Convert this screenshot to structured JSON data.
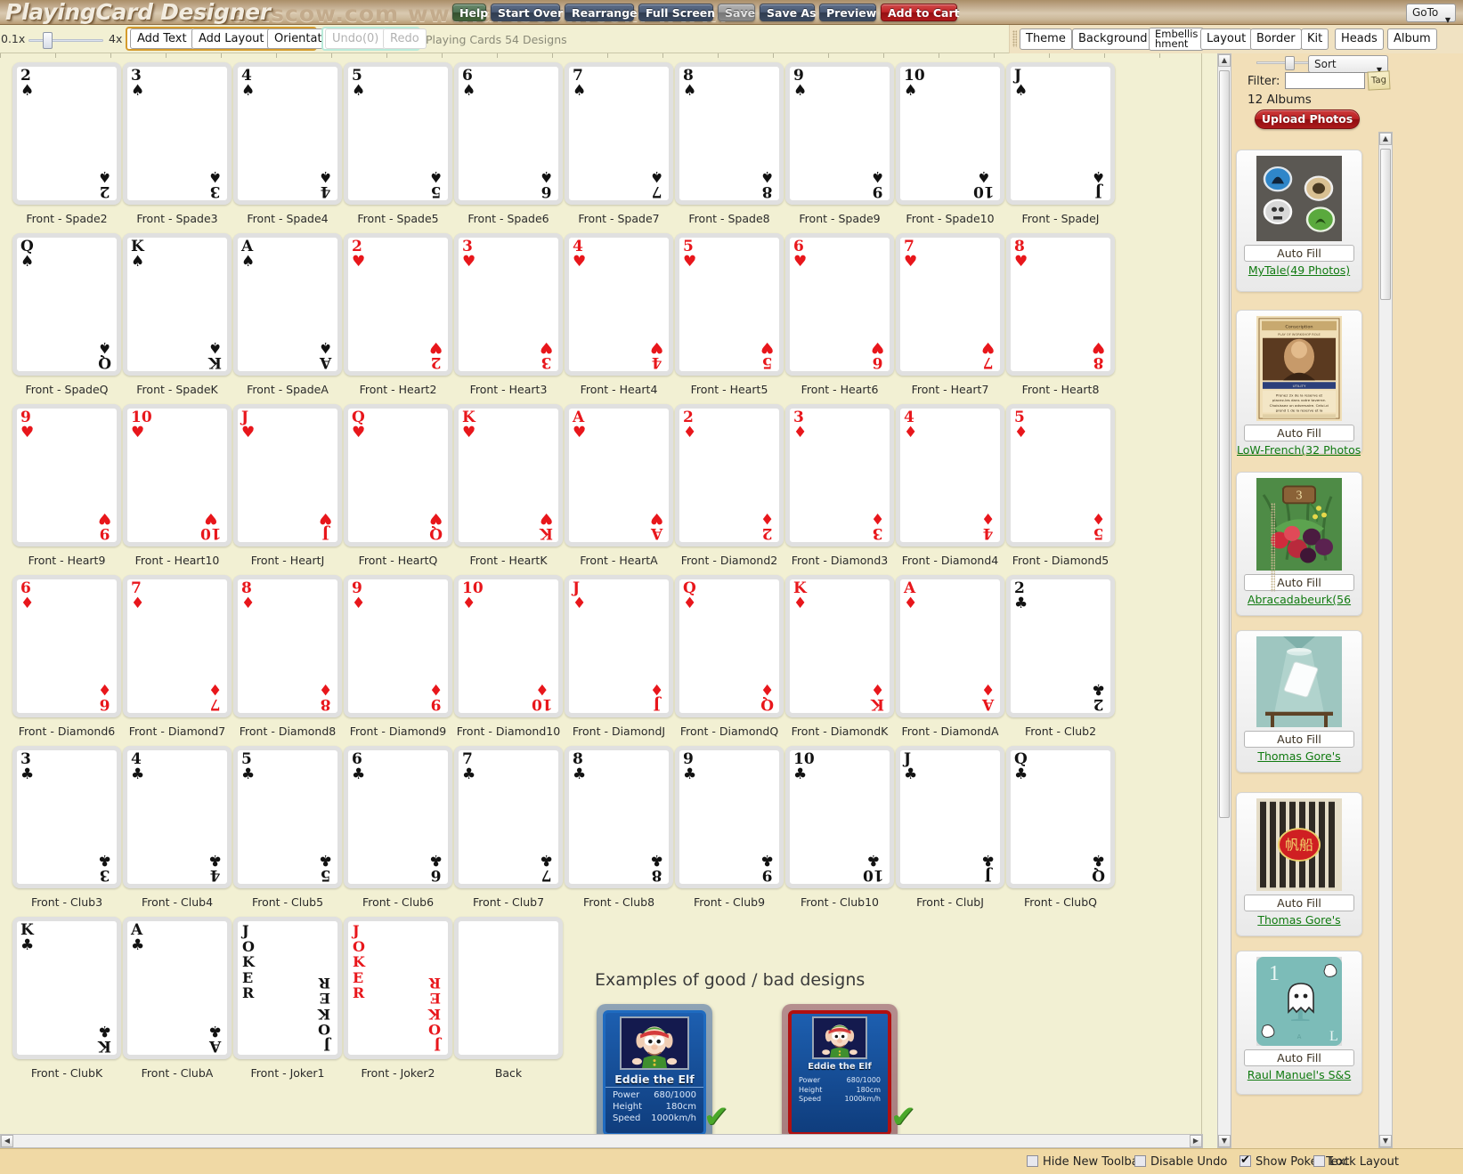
{
  "titlebar": {
    "app_title": "PlayingCard Designer",
    "watermark": "artscow.com www.artscow.com www.",
    "buttons": [
      {
        "label": "Help",
        "style": "green"
      },
      {
        "label": "Start Over",
        "style": "blue"
      },
      {
        "label": "Rearrange",
        "style": "blue"
      },
      {
        "label": "Full Screen",
        "style": "blue"
      },
      {
        "label": "Save",
        "style": "gray"
      },
      {
        "label": "Save As",
        "style": "blue"
      },
      {
        "label": "Preview",
        "style": "blue"
      },
      {
        "label": "Add to Cart",
        "style": "red"
      }
    ],
    "goto_label": "GoTo"
  },
  "toolbar": {
    "zoom_min": "0.1x",
    "zoom_max": "4x",
    "add_text": "Add Text",
    "add_layout": "Add Layout",
    "orientation": "Orientation",
    "undo": "Undo(0)",
    "redo": "Redo",
    "doc_label": "Playing Cards 54 Designs",
    "right_buttons": [
      "Theme",
      "Background",
      "Embellis|hment",
      "Layout",
      "Border",
      "Kit",
      "Heads",
      "Album"
    ]
  },
  "right_panel": {
    "sort_label": "Sort",
    "filter_label": "Filter:",
    "filter_value": "",
    "filter_placeholder": "",
    "tag_label": "Tag",
    "albums_count": "12 Albums",
    "upload_label": "Upload Photos",
    "auto_fill_label": "Auto Fill",
    "albums": [
      {
        "name": "MyTale(49 Photos)",
        "thumb": "tokens"
      },
      {
        "name": "LoW-French(32 Photos)",
        "thumb": "frenchcard"
      },
      {
        "name": "Abracadabeurk(56",
        "thumb": "berries"
      },
      {
        "name": "Thomas Gore's",
        "thumb": "lamp"
      },
      {
        "name": "Thomas Gore's",
        "thumb": "junk"
      },
      {
        "name": "Raul Manuel's S&S",
        "thumb": "ghost"
      }
    ]
  },
  "examples": {
    "title": "Examples of good / bad designs",
    "good": {
      "name": "Eddie the Elf",
      "stats": [
        {
          "k": "Power",
          "v": "680/1000"
        },
        {
          "k": "Height",
          "v": "180cm"
        },
        {
          "k": "Speed",
          "v": "1000km/h"
        }
      ]
    },
    "bad": {
      "name": "Eddie the Elf",
      "stats": [
        {
          "k": "Power",
          "v": "680/1000"
        },
        {
          "k": "Height",
          "v": "180cm"
        },
        {
          "k": "Speed",
          "v": "1000km/h"
        }
      ]
    },
    "check_glyph": "✔"
  },
  "statusbar": {
    "items": [
      {
        "label": "Hide New Toolbar",
        "checked": false
      },
      {
        "label": "Disable Undo",
        "checked": false
      },
      {
        "label": "Show Poker Text",
        "checked": true
      },
      {
        "label": "Lock Layout",
        "checked": false
      }
    ]
  },
  "cards": [
    {
      "rank": "2",
      "suit": "♠",
      "color": "black",
      "label": "Front - Spade2"
    },
    {
      "rank": "3",
      "suit": "♠",
      "color": "black",
      "label": "Front - Spade3"
    },
    {
      "rank": "4",
      "suit": "♠",
      "color": "black",
      "label": "Front - Spade4"
    },
    {
      "rank": "5",
      "suit": "♠",
      "color": "black",
      "label": "Front - Spade5"
    },
    {
      "rank": "6",
      "suit": "♠",
      "color": "black",
      "label": "Front - Spade6"
    },
    {
      "rank": "7",
      "suit": "♠",
      "color": "black",
      "label": "Front - Spade7"
    },
    {
      "rank": "8",
      "suit": "♠",
      "color": "black",
      "label": "Front - Spade8"
    },
    {
      "rank": "9",
      "suit": "♠",
      "color": "black",
      "label": "Front - Spade9"
    },
    {
      "rank": "10",
      "suit": "♠",
      "color": "black",
      "label": "Front - Spade10"
    },
    {
      "rank": "J",
      "suit": "♠",
      "color": "black",
      "label": "Front - SpadeJ"
    },
    {
      "rank": "Q",
      "suit": "♠",
      "color": "black",
      "label": "Front - SpadeQ"
    },
    {
      "rank": "K",
      "suit": "♠",
      "color": "black",
      "label": "Front - SpadeK"
    },
    {
      "rank": "A",
      "suit": "♠",
      "color": "black",
      "label": "Front - SpadeA"
    },
    {
      "rank": "2",
      "suit": "♥",
      "color": "red",
      "label": "Front - Heart2"
    },
    {
      "rank": "3",
      "suit": "♥",
      "color": "red",
      "label": "Front - Heart3"
    },
    {
      "rank": "4",
      "suit": "♥",
      "color": "red",
      "label": "Front - Heart4"
    },
    {
      "rank": "5",
      "suit": "♥",
      "color": "red",
      "label": "Front - Heart5"
    },
    {
      "rank": "6",
      "suit": "♥",
      "color": "red",
      "label": "Front - Heart6"
    },
    {
      "rank": "7",
      "suit": "♥",
      "color": "red",
      "label": "Front - Heart7"
    },
    {
      "rank": "8",
      "suit": "♥",
      "color": "red",
      "label": "Front - Heart8"
    },
    {
      "rank": "9",
      "suit": "♥",
      "color": "red",
      "label": "Front - Heart9"
    },
    {
      "rank": "10",
      "suit": "♥",
      "color": "red",
      "label": "Front - Heart10"
    },
    {
      "rank": "J",
      "suit": "♥",
      "color": "red",
      "label": "Front - HeartJ"
    },
    {
      "rank": "Q",
      "suit": "♥",
      "color": "red",
      "label": "Front - HeartQ"
    },
    {
      "rank": "K",
      "suit": "♥",
      "color": "red",
      "label": "Front - HeartK"
    },
    {
      "rank": "A",
      "suit": "♥",
      "color": "red",
      "label": "Front - HeartA"
    },
    {
      "rank": "2",
      "suit": "♦",
      "color": "red",
      "label": "Front - Diamond2"
    },
    {
      "rank": "3",
      "suit": "♦",
      "color": "red",
      "label": "Front - Diamond3"
    },
    {
      "rank": "4",
      "suit": "♦",
      "color": "red",
      "label": "Front - Diamond4"
    },
    {
      "rank": "5",
      "suit": "♦",
      "color": "red",
      "label": "Front - Diamond5"
    },
    {
      "rank": "6",
      "suit": "♦",
      "color": "red",
      "label": "Front - Diamond6"
    },
    {
      "rank": "7",
      "suit": "♦",
      "color": "red",
      "label": "Front - Diamond7"
    },
    {
      "rank": "8",
      "suit": "♦",
      "color": "red",
      "label": "Front - Diamond8"
    },
    {
      "rank": "9",
      "suit": "♦",
      "color": "red",
      "label": "Front - Diamond9"
    },
    {
      "rank": "10",
      "suit": "♦",
      "color": "red",
      "label": "Front - Diamond10"
    },
    {
      "rank": "J",
      "suit": "♦",
      "color": "red",
      "label": "Front - DiamondJ"
    },
    {
      "rank": "Q",
      "suit": "♦",
      "color": "red",
      "label": "Front - DiamondQ"
    },
    {
      "rank": "K",
      "suit": "♦",
      "color": "red",
      "label": "Front - DiamondK"
    },
    {
      "rank": "A",
      "suit": "♦",
      "color": "red",
      "label": "Front - DiamondA"
    },
    {
      "rank": "2",
      "suit": "♣",
      "color": "black",
      "label": "Front - Club2"
    },
    {
      "rank": "3",
      "suit": "♣",
      "color": "black",
      "label": "Front - Club3"
    },
    {
      "rank": "4",
      "suit": "♣",
      "color": "black",
      "label": "Front - Club4"
    },
    {
      "rank": "5",
      "suit": "♣",
      "color": "black",
      "label": "Front - Club5"
    },
    {
      "rank": "6",
      "suit": "♣",
      "color": "black",
      "label": "Front - Club6"
    },
    {
      "rank": "7",
      "suit": "♣",
      "color": "black",
      "label": "Front - Club7"
    },
    {
      "rank": "8",
      "suit": "♣",
      "color": "black",
      "label": "Front - Club8"
    },
    {
      "rank": "9",
      "suit": "♣",
      "color": "black",
      "label": "Front - Club9"
    },
    {
      "rank": "10",
      "suit": "♣",
      "color": "black",
      "label": "Front - Club10"
    },
    {
      "rank": "J",
      "suit": "♣",
      "color": "black",
      "label": "Front - ClubJ"
    },
    {
      "rank": "Q",
      "suit": "♣",
      "color": "black",
      "label": "Front - ClubQ"
    },
    {
      "rank": "K",
      "suit": "♣",
      "color": "black",
      "label": "Front - ClubK"
    },
    {
      "rank": "A",
      "suit": "♣",
      "color": "black",
      "label": "Front - ClubA"
    },
    {
      "rank": "JOKER",
      "suit": "",
      "color": "black",
      "label": "Front - Joker1",
      "type": "joker"
    },
    {
      "rank": "JOKER",
      "suit": "",
      "color": "red",
      "label": "Front - Joker2",
      "type": "joker"
    },
    {
      "rank": "",
      "suit": "",
      "color": "black",
      "label": "Back",
      "type": "back"
    }
  ]
}
